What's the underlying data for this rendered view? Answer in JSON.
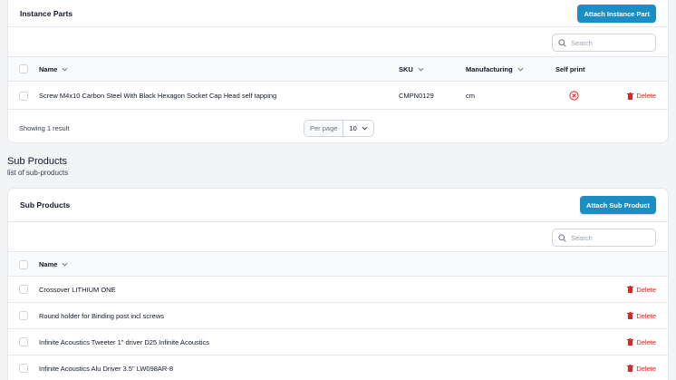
{
  "instance_parts": {
    "title": "Instance Parts",
    "attach_label": "Attach Instance Part",
    "search_placeholder": "Search",
    "columns": {
      "name": "Name",
      "sku": "SKU",
      "manufacturing": "Manufacturing",
      "self_print": "Self print"
    },
    "rows": [
      {
        "name": "Screw M4x10 Carbon Steel With Black Hexagon Socket Cap Head self tapping",
        "sku": "CMPN0129",
        "manufacturing": "cm",
        "delete_label": "Delete"
      }
    ],
    "footer": {
      "showing": "Showing 1 result",
      "per_page_label": "Per page",
      "per_page_value": "10"
    }
  },
  "sub_products_section": {
    "heading": "Sub Products",
    "subheading": "list of sub-products"
  },
  "sub_products": {
    "title": "Sub Products",
    "attach_label": "Attach Sub Product",
    "search_placeholder": "Search",
    "columns": {
      "name": "Name"
    },
    "rows": [
      {
        "name": "Crossover LITHIUM ONE",
        "delete_label": "Delete"
      },
      {
        "name": "Round holder for Binding post incl screws",
        "delete_label": "Delete"
      },
      {
        "name": "Infinite Acoustics Tweeter 1\" driver D25 Infinite Acoustics",
        "delete_label": "Delete"
      },
      {
        "name": "Infinite Acoustics Alu Driver 3.5\" LW098AR-8",
        "delete_label": "Delete"
      }
    ]
  },
  "colors": {
    "accent": "#1b8fc4",
    "danger": "#dc2626"
  }
}
